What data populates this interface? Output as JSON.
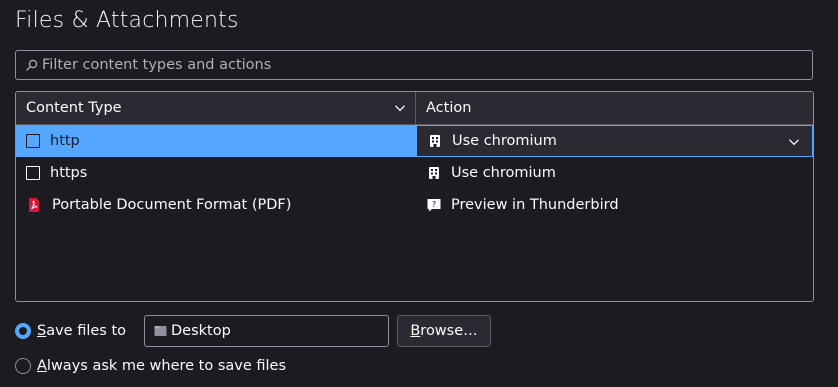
{
  "page": {
    "title": "Files & Attachments"
  },
  "search": {
    "placeholder": "Filter content types and actions",
    "value": ""
  },
  "table": {
    "headers": {
      "content_type": "Content Type",
      "action": "Action"
    },
    "rows": [
      {
        "type": "http",
        "action": "Use chromium",
        "type_icon": "checkbox-icon",
        "action_icon": "application-icon",
        "selected": true
      },
      {
        "type": "https",
        "action": "Use chromium",
        "type_icon": "checkbox-icon",
        "action_icon": "application-icon",
        "selected": false
      },
      {
        "type": "Portable Document Format (PDF)",
        "action": "Preview in Thunderbird",
        "type_icon": "pdf-icon",
        "action_icon": "preview-icon",
        "selected": false
      }
    ]
  },
  "save": {
    "save_files_label_prefix": "",
    "save_files_label_accesskey": "S",
    "save_files_label_rest": "ave files to",
    "folder_value": "Desktop",
    "browse_label_accesskey": "B",
    "browse_label_rest": "rowse…",
    "always_ask_label_accesskey": "A",
    "always_ask_label_rest": "lways ask me where to save files"
  },
  "colors": {
    "background": "#1c1b22",
    "accent": "#54a6ff",
    "header_bg": "#2b2a33",
    "border": "#8f8f9d",
    "text": "#fbfbfe"
  }
}
